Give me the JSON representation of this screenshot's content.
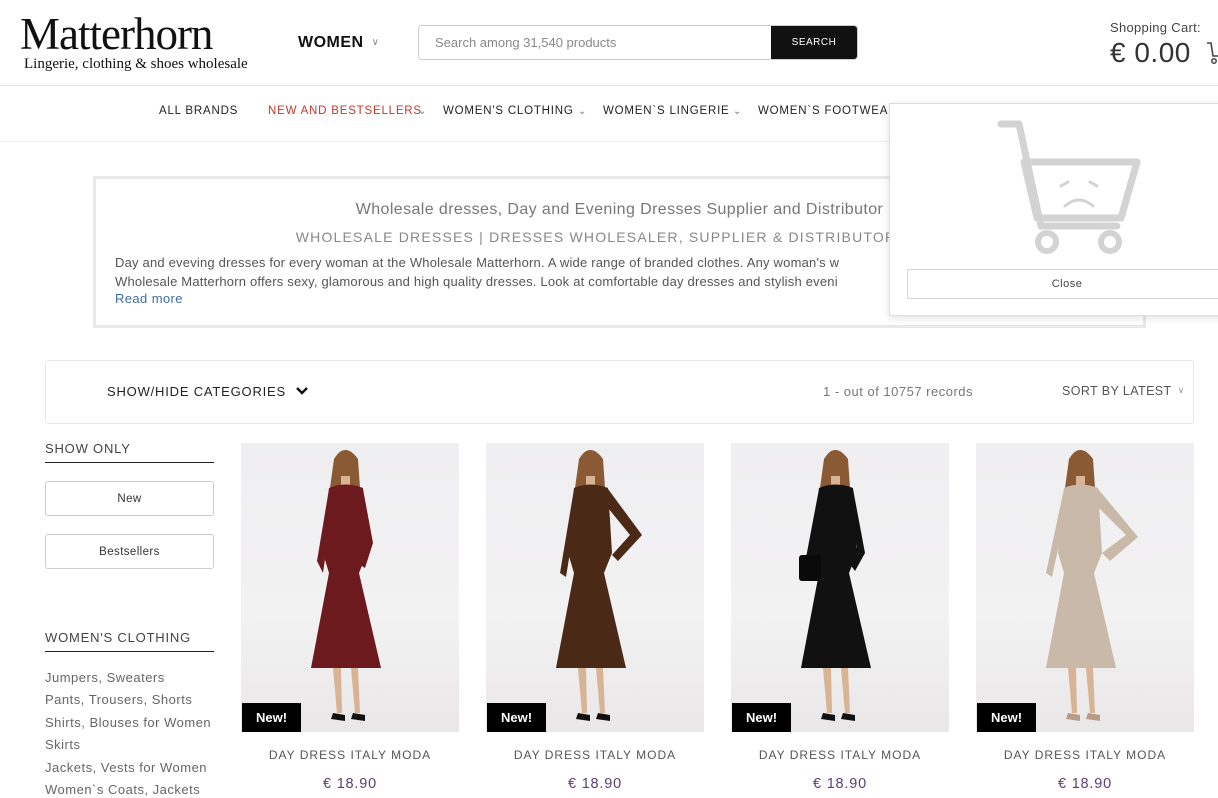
{
  "header": {
    "logo_main": "Matterhorn",
    "logo_sub": "Lingerie, clothing & shoes wholesale",
    "gender_selector": "WOMEN",
    "search": {
      "placeholder": "Search among 31,540 products",
      "button": "SEARCH"
    },
    "cart": {
      "label": "Shopping Cart:",
      "total": "€ 0.00"
    }
  },
  "nav": {
    "items": [
      {
        "label": "ALL BRANDS",
        "highlight": false,
        "has_dropdown": false
      },
      {
        "label": "NEW AND BESTSELLERS",
        "highlight": true,
        "has_dropdown": true
      },
      {
        "label": "WOMEN'S CLOTHING",
        "highlight": false,
        "has_dropdown": true
      },
      {
        "label": "WOMEN`S LINGERIE",
        "highlight": false,
        "has_dropdown": true
      },
      {
        "label": "WOMEN`S FOOTWEAR",
        "highlight": false,
        "has_dropdown": false
      }
    ],
    "accent_color": "#c0392b"
  },
  "banner": {
    "title": "Wholesale dresses, Day and Evening Dresses Supplier and Distributor",
    "subtitle": "WHOLESALE DRESSES | DRESSES WHOLESALER, SUPPLIER & DISTRIBUTOR MATT",
    "text_line1": "Day and eveving dresses for every woman at the Wholesale Matterhorn. A wide range of branded clothes. Any woman's w",
    "text_line2": "Wholesale Matterhorn offers sexy, glamorous and high quality dresses. Look at comfortable day dresses and stylish eveni",
    "read_more": "Read more"
  },
  "cart_popup": {
    "icon": "empty-cart-sad-icon",
    "close_label": "Close"
  },
  "toolbar": {
    "show_hide": "SHOW/HIDE CATEGORIES",
    "records": "1 - out of 10757 records",
    "sort": "SORT BY LATEST"
  },
  "sidebar": {
    "show_only_heading": "SHOW ONLY",
    "buttons": [
      "New",
      "Bestsellers"
    ],
    "clothing_heading": "WOMEN'S CLOTHING",
    "links": [
      "Jumpers, Sweaters",
      "Pants, Trousers, Shorts",
      "Shirts, Blouses for Women",
      "Skirts",
      "Jackets, Vests for Women",
      "Women`s Coats, Jackets"
    ]
  },
  "products": [
    {
      "name": "DAY DRESS ITALY MODA",
      "price": "€ 18.90",
      "badge": "New!",
      "dress_color": "#6d1a1f"
    },
    {
      "name": "DAY DRESS ITALY MODA",
      "price": "€ 18.90",
      "badge": "New!",
      "dress_color": "#4a2a17"
    },
    {
      "name": "DAY DRESS ITALY MODA",
      "price": "€ 18.90",
      "badge": "New!",
      "dress_color": "#111111"
    },
    {
      "name": "DAY DRESS ITALY MODA",
      "price": "€ 18.90",
      "badge": "New!",
      "dress_color": "#c9b9a8"
    }
  ]
}
